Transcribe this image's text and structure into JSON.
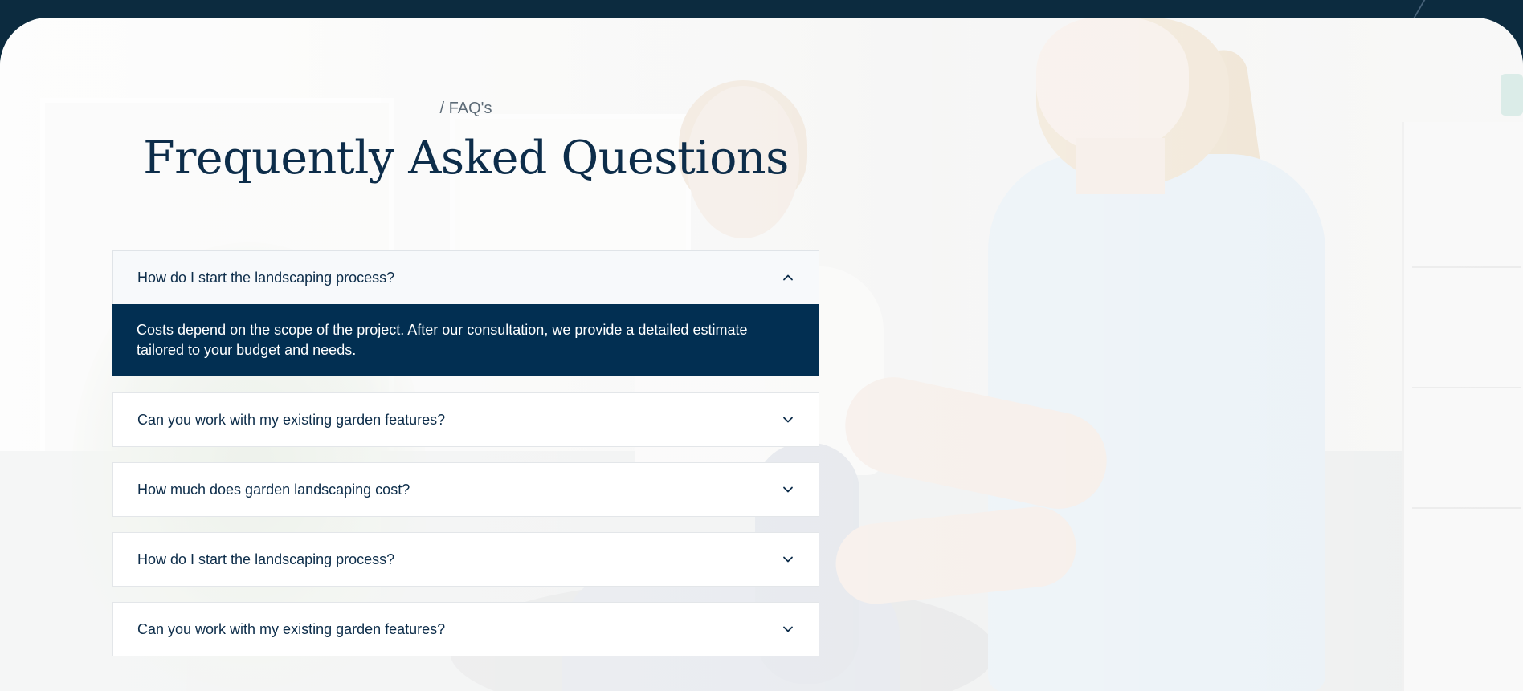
{
  "faq": {
    "eyebrow": "/ FAQ's",
    "title": "Frequently Asked Questions",
    "items": [
      {
        "question": "How do I start the landscaping process?",
        "answer": "Costs depend on the scope of the project. After our consultation, we provide a detailed estimate tailored to your budget and needs.",
        "expanded": true
      },
      {
        "question": "Can you work with my existing garden features?",
        "expanded": false
      },
      {
        "question": "How much does garden landscaping cost?",
        "expanded": false
      },
      {
        "question": "How do I start the landscaping process?",
        "expanded": false
      },
      {
        "question": "Can you work with my existing garden features?",
        "expanded": false
      }
    ]
  },
  "colors": {
    "navy": "#0d2d4a",
    "answer_bg": "#022f52",
    "header_bar": "#0c2b3f"
  },
  "icons": {
    "expanded": "chevron-up-icon",
    "collapsed": "chevron-down-icon"
  }
}
